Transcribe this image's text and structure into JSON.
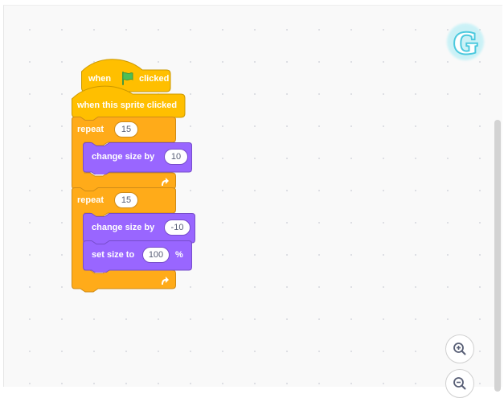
{
  "workspace": {
    "logo_letter": "G",
    "zoom": {
      "zoom_in_icon": "zoom-in-icon",
      "zoom_out_icon": "zoom-out-icon"
    }
  },
  "script": {
    "hat1": {
      "prefix": "when",
      "flag_icon": "green-flag-icon",
      "suffix": "clicked"
    },
    "hat2": {
      "label": "when this sprite clicked"
    },
    "repeat1": {
      "label": "repeat",
      "count": "15"
    },
    "change1": {
      "label": "change size by",
      "value": "10"
    },
    "repeat2": {
      "label": "repeat",
      "count": "15"
    },
    "change2": {
      "label": "change size by",
      "value": "-10"
    },
    "setsize": {
      "label": "set size to",
      "value": "100",
      "unit": "%"
    }
  },
  "colors": {
    "events": "#ffbf00",
    "events_border": "#cc9900",
    "control": "#ffab19",
    "control_border": "#cf8b17",
    "looks": "#9966ff",
    "looks_border": "#774dcb",
    "logo": "#4cc9de"
  }
}
